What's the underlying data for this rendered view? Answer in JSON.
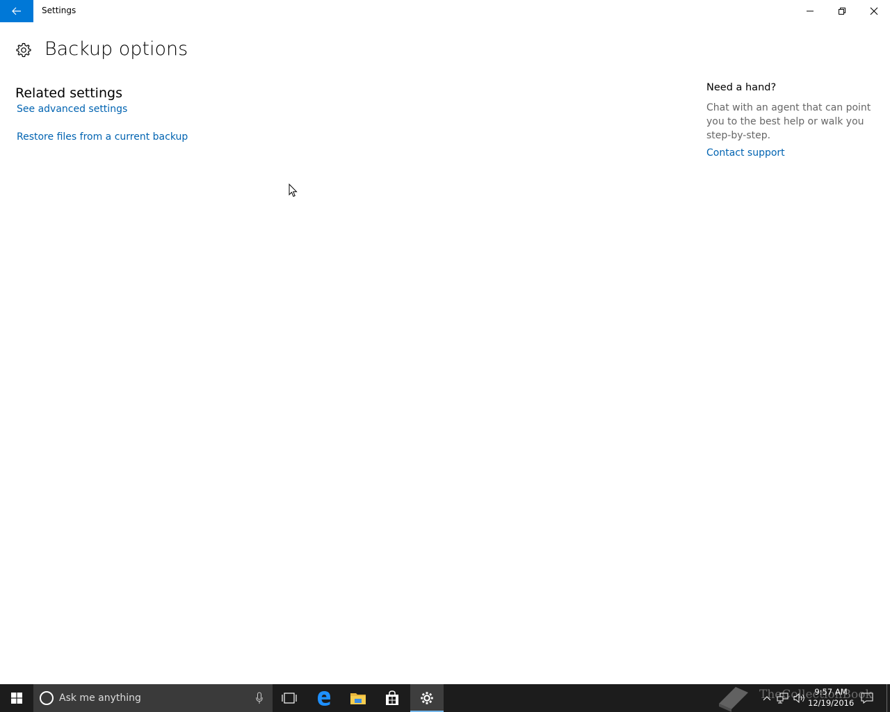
{
  "window": {
    "title": "Settings",
    "back_icon": "arrow-left-icon",
    "accent": "#0078d7"
  },
  "page": {
    "icon": "gear-icon",
    "title": "Backup options"
  },
  "related": {
    "heading": "Related settings",
    "links": [
      {
        "label": "See advanced settings"
      },
      {
        "label": "Restore files from a current backup"
      }
    ],
    "link_color": "#0063b1"
  },
  "help": {
    "heading": "Need a hand?",
    "body": "Chat with an agent that can point you to the best help or walk you step-by-step.",
    "link": "Contact support"
  },
  "taskbar": {
    "search_placeholder": "Ask me anything",
    "apps": [
      "task-view-icon",
      "edge-icon",
      "file-explorer-icon",
      "store-icon",
      "settings-icon"
    ],
    "active_app": "settings-icon",
    "clock": {
      "time": "9:57 AM",
      "date": "12/19/2016"
    },
    "watermark": "TheCollectionBook"
  }
}
